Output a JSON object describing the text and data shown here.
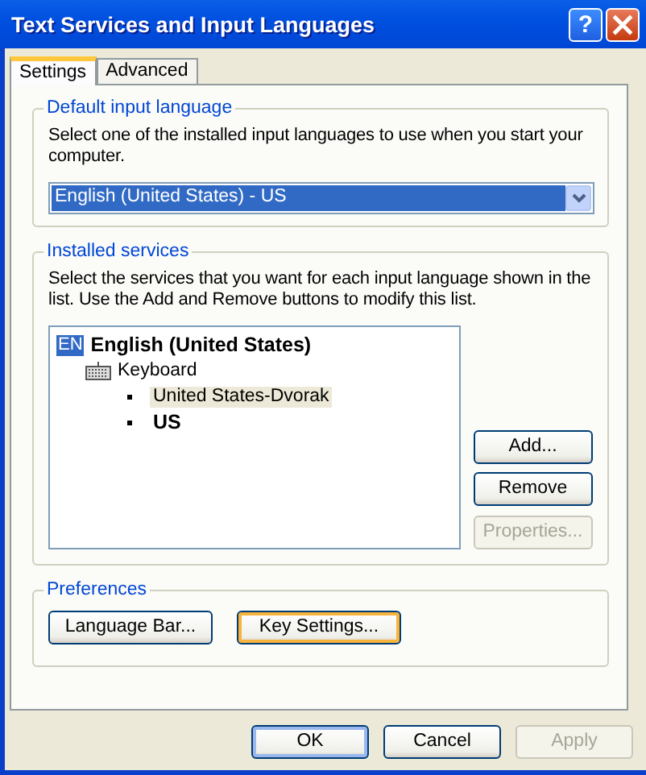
{
  "window": {
    "title": "Text Services and Input Languages",
    "help_label": "?"
  },
  "tabs": [
    {
      "label": "Settings",
      "selected": true
    },
    {
      "label": "Advanced",
      "selected": false
    }
  ],
  "default_language": {
    "title": "Default input language",
    "description": "Select one of the installed input languages to use when you start your computer.",
    "dropdown": {
      "value": "English (United States) - US"
    }
  },
  "installed_services": {
    "title": "Installed services",
    "description": "Select the services that you want for each input language shown in the list. Use the Add and Remove buttons to modify this list.",
    "tree": [
      {
        "badge": "EN",
        "label": "English (United States)",
        "children": [
          {
            "label": "Keyboard",
            "children": [
              {
                "label": "United States-Dvorak",
                "selected": true,
                "default": false
              },
              {
                "label": "US",
                "selected": false,
                "default": true
              }
            ]
          }
        ]
      }
    ],
    "buttons": [
      {
        "label": "Add...",
        "disabled": false
      },
      {
        "label": "Remove",
        "disabled": false
      },
      {
        "label": "Properties...",
        "disabled": true
      }
    ]
  },
  "preferences": {
    "title": "Preferences",
    "buttons": [
      {
        "label": "Language Bar...",
        "focused": false
      },
      {
        "label": "Key Settings...",
        "focused": true
      }
    ]
  },
  "footer_buttons": [
    {
      "label": "OK",
      "default": true,
      "disabled": false
    },
    {
      "label": "Cancel",
      "default": false,
      "disabled": false
    },
    {
      "label": "Apply",
      "default": false,
      "disabled": true
    }
  ]
}
